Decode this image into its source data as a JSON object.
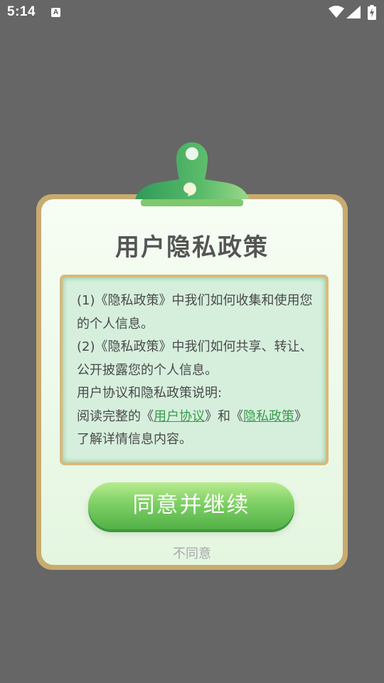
{
  "status_bar": {
    "time": "5:14",
    "notification_icon": "A"
  },
  "dialog": {
    "title": "用户隐私政策",
    "paragraphs": [
      "(1)《隐私政策》中我们如何收集和使用您的个人信息。",
      "(2)《隐私政策》中我们如何共享、转让、公开披露您的个人信息。",
      "用户协议和隐私政策说明:"
    ],
    "last_line": {
      "prefix": "阅读完整的《",
      "link1": "用户协议",
      "middle": "》和《",
      "link2": "隐私政策",
      "suffix": "》了解详情信息内容。"
    },
    "agree_label": "同意并继续",
    "disagree_label": "不同意"
  },
  "colors": {
    "background": "#666666",
    "card_border": "#c8ab6f",
    "accent_green": "#5cb84f",
    "link_green": "#3a9a4c"
  }
}
